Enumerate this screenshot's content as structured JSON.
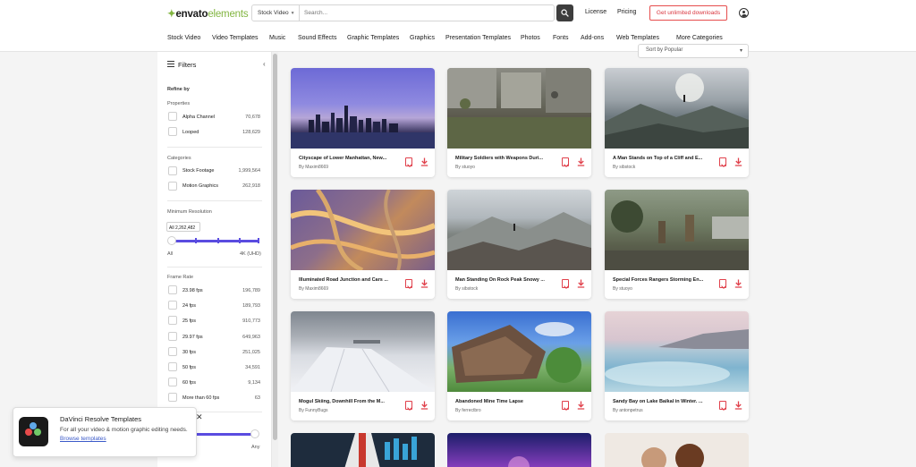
{
  "header": {
    "logo_main": "envato",
    "logo_sub": "elements",
    "search_type": "Stock Video",
    "search_placeholder": "Search...",
    "license": "License",
    "pricing": "Pricing",
    "cta": "Get unlimited downloads",
    "colors": {
      "brand_green": "#82b541",
      "cta_red": "#d9363e"
    }
  },
  "nav": [
    "Stock Video",
    "Video Templates",
    "Music",
    "Sound Effects",
    "Graphic Templates",
    "Graphics",
    "Presentation Templates",
    "Photos",
    "Fonts",
    "Add-ons",
    "Web Templates",
    "More Categories"
  ],
  "sidebar": {
    "title": "Filters",
    "refine_by": "Refine by",
    "properties": {
      "heading": "Properties",
      "items": [
        {
          "label": "Alpha Channel",
          "count": "70,678"
        },
        {
          "label": "Looped",
          "count": "128,629"
        }
      ]
    },
    "categories": {
      "heading": "Categories",
      "items": [
        {
          "label": "Stock Footage",
          "count": "1,999,564"
        },
        {
          "label": "Motion Graphics",
          "count": "262,918"
        }
      ]
    },
    "resolution": {
      "heading": "Minimum Resolution",
      "tooltip": "All 2,262,482",
      "min": "All",
      "max": "4K (UHD)"
    },
    "frame_rate": {
      "heading": "Frame Rate",
      "items": [
        {
          "label": "23.98 fps",
          "count": "196,789"
        },
        {
          "label": "24 fps",
          "count": "189,793"
        },
        {
          "label": "25 fps",
          "count": "910,773"
        },
        {
          "label": "29.97 fps",
          "count": "649,963"
        },
        {
          "label": "30 fps",
          "count": "251,025"
        },
        {
          "label": "50 fps",
          "count": "34,591"
        },
        {
          "label": "60 fps",
          "count": "9,134"
        },
        {
          "label": "More than 60 fps",
          "count": "63"
        }
      ]
    },
    "duration_max": "Any",
    "accent_color": "#5a4ce0"
  },
  "toast": {
    "title": "DaVinci Resolve Templates",
    "body": "For all your video & motion graphic editing needs.",
    "link": "Browse templates"
  },
  "sort": {
    "label": "Sort by Popular"
  },
  "cards": [
    {
      "title": "Cityscape of Lower Manhattan, New...",
      "author": "By Maxim8669"
    },
    {
      "title": "Military Soldiers with Weapons Duri...",
      "author": "By stuoyo"
    },
    {
      "title": "A Man Stands on Top of a Cliff and E...",
      "author": "By sibstock"
    },
    {
      "title": "Illuminated Road Junction and Cars ...",
      "author": "By Maxim8669"
    },
    {
      "title": "Man Standing On Rock Peak Snowy ...",
      "author": "By sibstock"
    },
    {
      "title": "Special Forces Rangers Storming En...",
      "author": "By stuoyo"
    },
    {
      "title": "Mogul Skiing, Downhill From the M...",
      "author": "By FunnyBugs"
    },
    {
      "title": "Abandoned Mine Time Lapse",
      "author": "By ferrectbro"
    },
    {
      "title": "Sandy Bay on Lake Baikal in Winter. ...",
      "author": "By antonpetrus"
    }
  ]
}
